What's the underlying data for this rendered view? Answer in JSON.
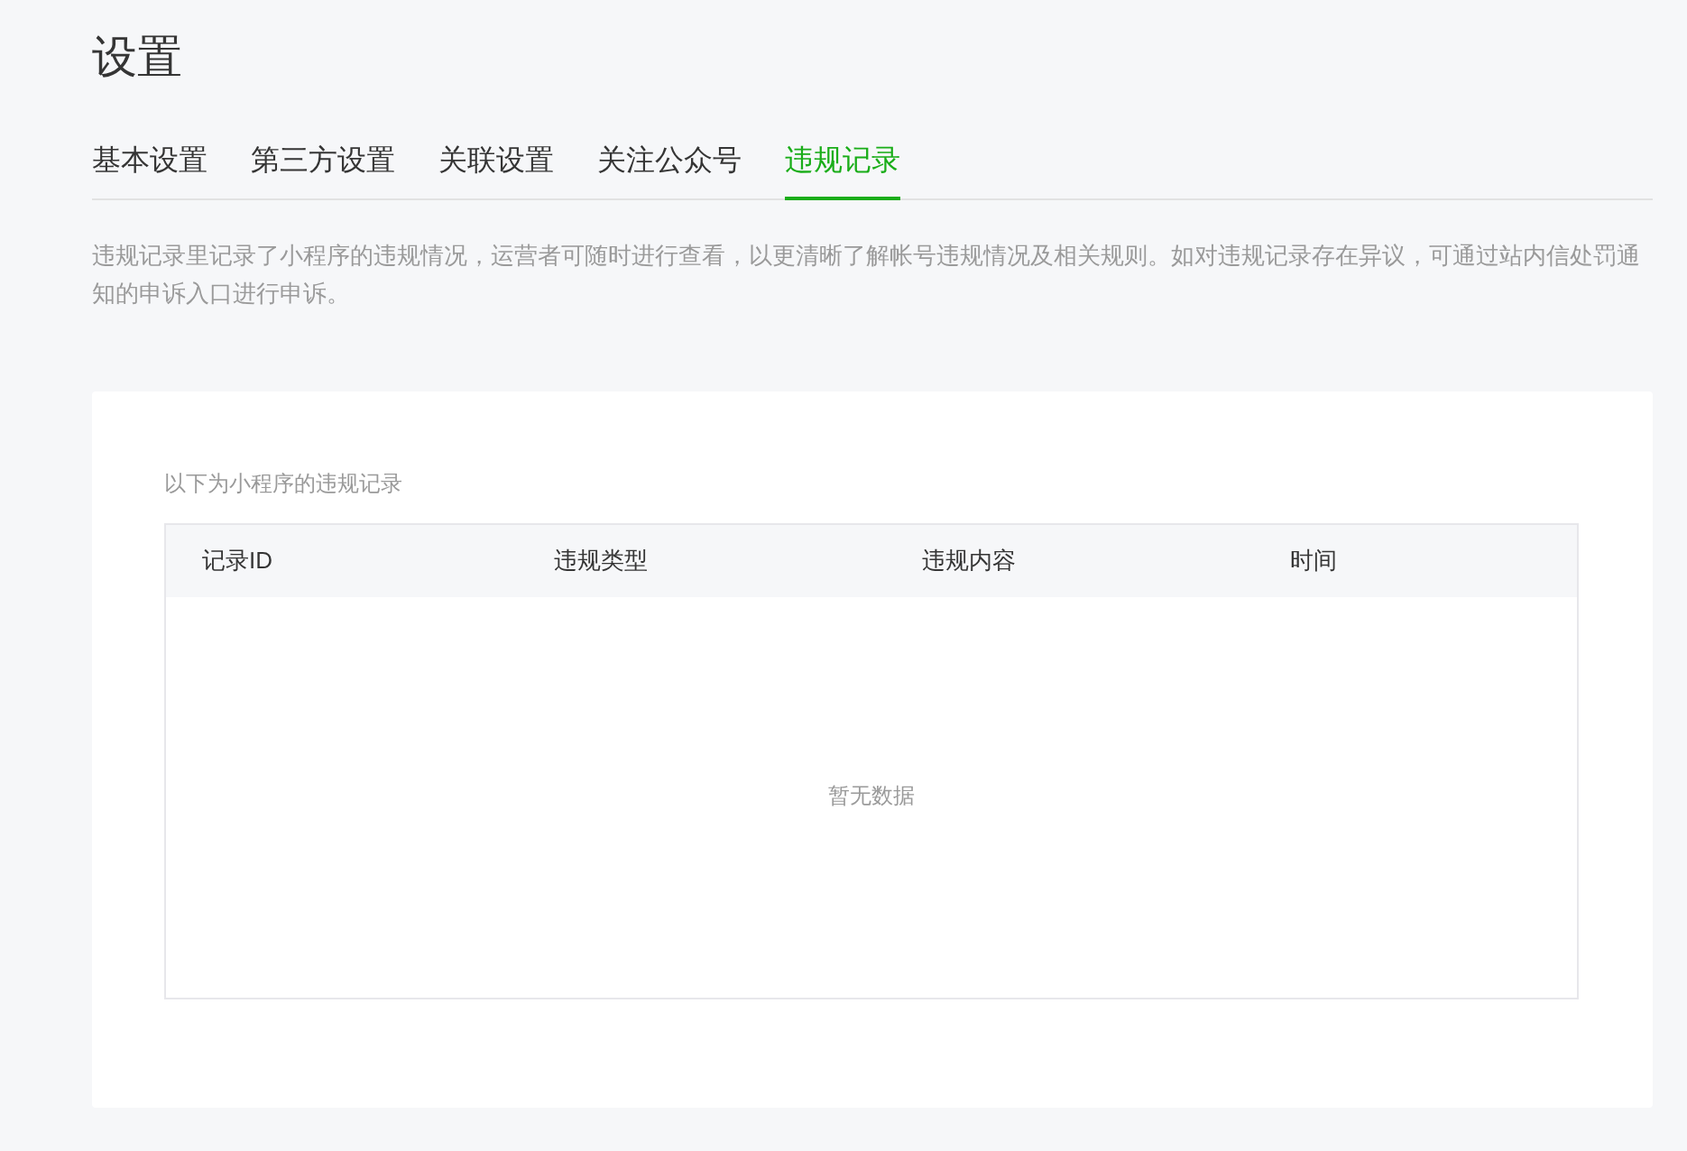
{
  "title": "设置",
  "tabs": [
    {
      "label": "基本设置",
      "selected": false
    },
    {
      "label": "第三方设置",
      "selected": false
    },
    {
      "label": "关联设置",
      "selected": false
    },
    {
      "label": "关注公众号",
      "selected": false
    },
    {
      "label": "违规记录",
      "selected": true
    }
  ],
  "description": "违规记录里记录了小程序的违规情况，运营者可随时进行查看，以更清晰了解帐号违规情况及相关规则。如对违规记录存在异议，可通过站内信处罚通知的申诉入口进行申诉。",
  "card": {
    "caption": "以下为小程序的违规记录",
    "table": {
      "columns": [
        "记录ID",
        "违规类型",
        "违规内容",
        "时间"
      ],
      "empty_text": "暂无数据"
    }
  }
}
